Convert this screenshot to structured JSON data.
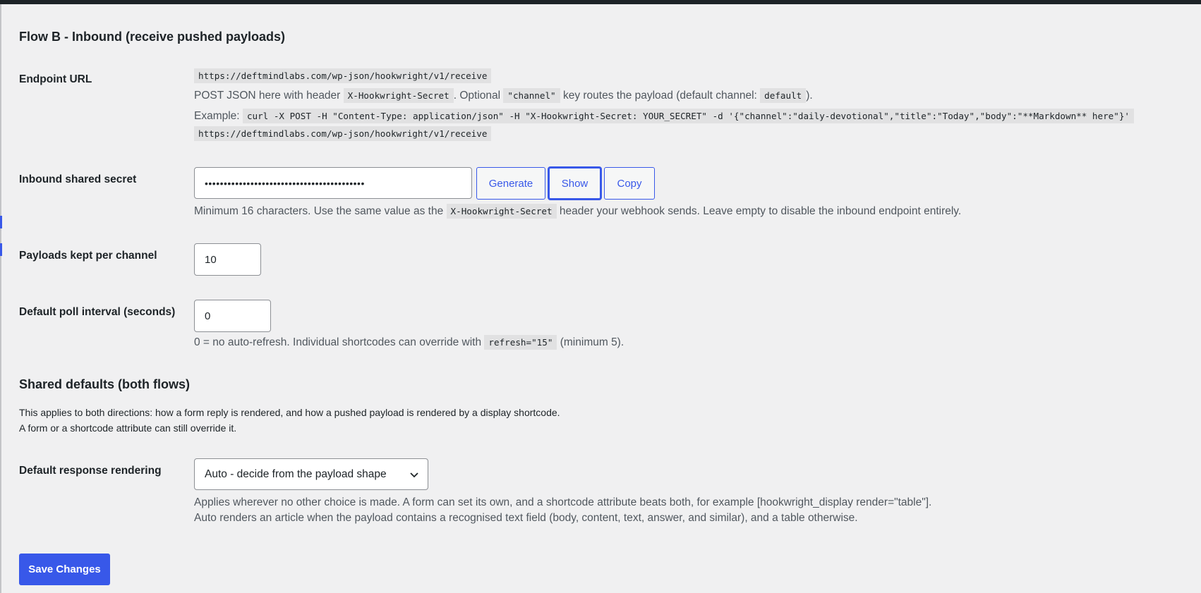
{
  "flow_b": {
    "heading": "Flow B - Inbound (receive pushed payloads)",
    "endpoint": {
      "label": "Endpoint URL",
      "url": "https://deftmindlabs.com/wp-json/hookwright/v1/receive",
      "desc_prefix": "POST JSON here with header",
      "header_code": "X-Hookwright-Secret",
      "desc_middle": ". Optional",
      "channel_code": "\"channel\"",
      "desc_suffix": "key routes the payload (default channel:",
      "default_code": "default",
      "desc_end": ").",
      "example_label": "Example:",
      "example_code": "curl -X POST -H \"Content-Type: application/json\" -H \"X-Hookwright-Secret: YOUR_SECRET\" -d '{\"channel\":\"daily-devotional\",\"title\":\"Today\",\"body\":\"**Markdown** here\"}'",
      "example_url": "https://deftmindlabs.com/wp-json/hookwright/v1/receive"
    },
    "secret": {
      "label": "Inbound shared secret",
      "value": "••••••••••••••••••••••••••••••••••••••••••",
      "generate_label": "Generate",
      "show_label": "Show",
      "copy_label": "Copy",
      "help_prefix": "Minimum 16 characters. Use the same value as the",
      "help_code": "X-Hookwright-Secret",
      "help_suffix": "header your webhook sends. Leave empty to disable the inbound endpoint entirely."
    },
    "payloads": {
      "label": "Payloads kept per channel",
      "value": "10"
    },
    "poll": {
      "label": "Default poll interval (seconds)",
      "value": "0",
      "help_prefix": "0 = no auto-refresh. Individual shortcodes can override with",
      "help_code": "refresh=\"15\"",
      "help_suffix": "(minimum 5)."
    }
  },
  "shared": {
    "heading": "Shared defaults (both flows)",
    "intro_line1": "This applies to both directions: how a form reply is rendered, and how a pushed payload is rendered by a display shortcode.",
    "intro_line2": "A form or a shortcode attribute can still override it.",
    "rendering": {
      "label": "Default response rendering",
      "selected": "Auto - decide from the payload shape",
      "help_line1": "Applies wherever no other choice is made. A form can set its own, and a shortcode attribute beats both, for example [hookwright_display render=\"table\"].",
      "help_line2": "Auto renders an article when the payload contains a recognised text field (body, content, text, answer, and similar), and a table otherwise."
    }
  },
  "save_label": "Save Changes",
  "colors": {
    "accent": "#3858e9",
    "text": "#1d2327",
    "muted": "#50575e",
    "background": "#f0f0f1",
    "code_bg": "#e1e1e2"
  }
}
